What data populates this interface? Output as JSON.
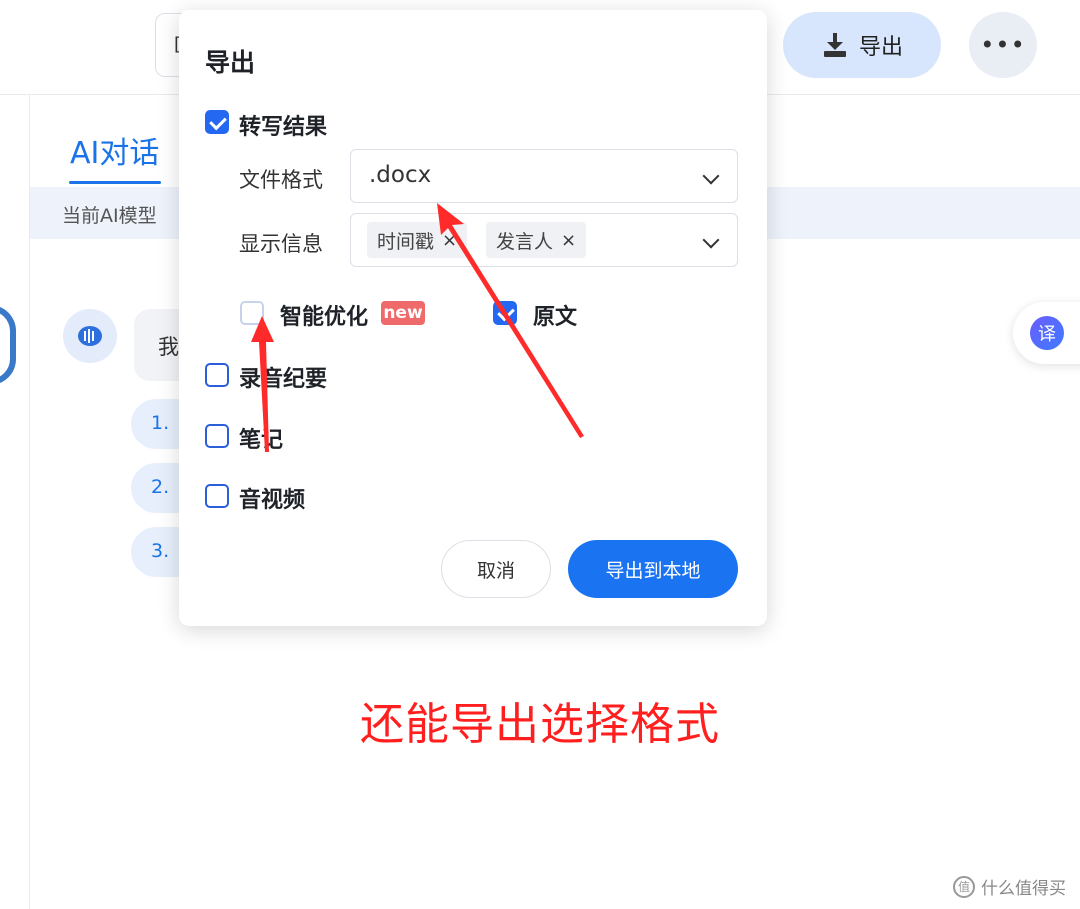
{
  "header": {
    "search_stub_text": "[",
    "export_button_label": "导出",
    "more_button_label": "•••"
  },
  "main": {
    "tab_ai_label": "AI对话",
    "model_bar_text": "当前AI模型",
    "bot_message": "我",
    "suggestions": [
      "1.",
      "2.",
      "3."
    ]
  },
  "translate_fab_label": "译",
  "dialog": {
    "title": "导出",
    "transcription": {
      "label": "转写结果",
      "checked": true
    },
    "file_format": {
      "label": "文件格式",
      "value": ".docx"
    },
    "display_info": {
      "label": "显示信息",
      "tags": [
        "时间戳",
        "发言人"
      ],
      "tag_remove": "×"
    },
    "smart_optimize": {
      "label": "智能优化",
      "badge": "new",
      "checked": false
    },
    "original": {
      "label": "原文",
      "checked": true
    },
    "recording_summary": {
      "label": "录音纪要",
      "checked": false
    },
    "notes": {
      "label": "笔记",
      "checked": false
    },
    "audio_video": {
      "label": "音视频",
      "checked": false
    },
    "cancel_label": "取消",
    "confirm_label": "导出到本地"
  },
  "annotation": {
    "text": "还能导出选择格式",
    "color": "#ff1f1f"
  },
  "watermark": {
    "text": "什么值得买",
    "logo": "值"
  },
  "colors": {
    "accent": "#1a73f0",
    "checkbox": "#2468f2",
    "badge": "#ef6a6a"
  }
}
